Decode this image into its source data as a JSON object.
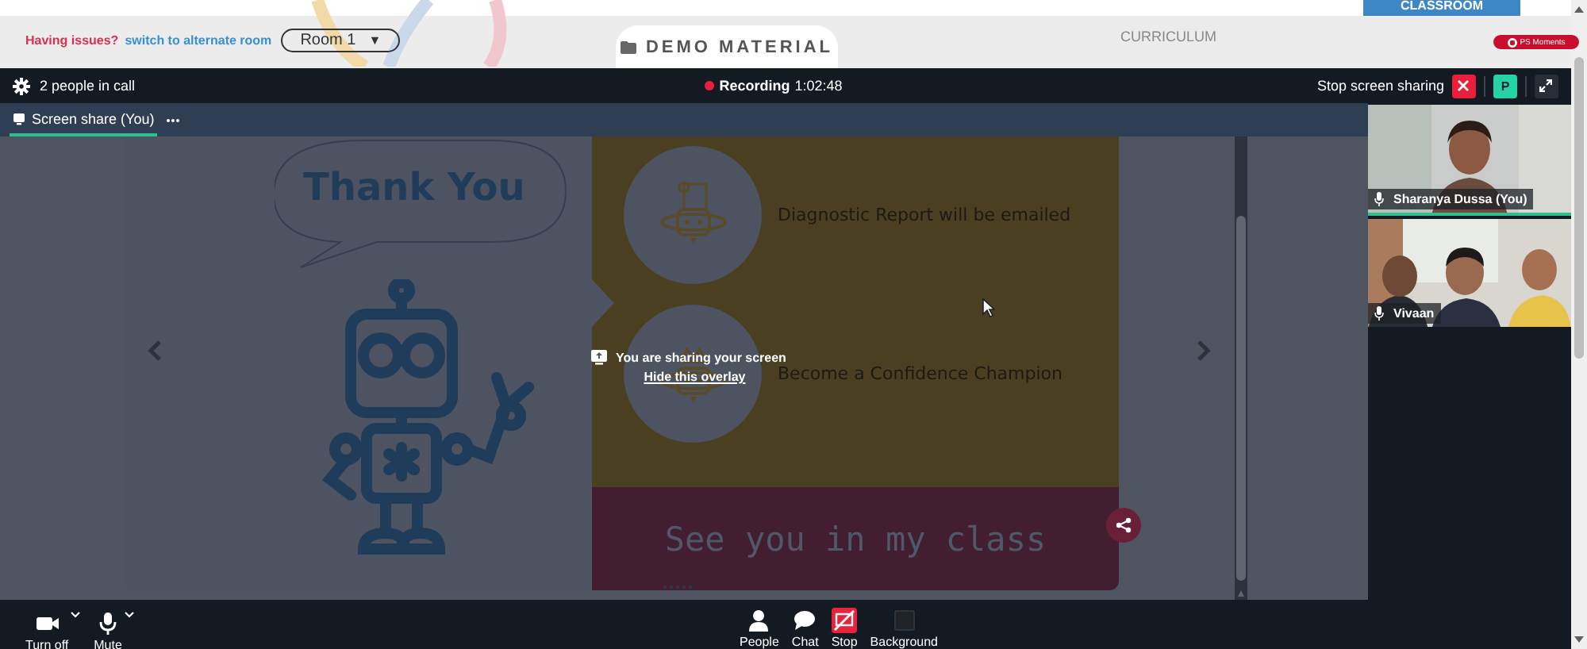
{
  "header": {
    "issue_text": "Having issues?",
    "switch_link": "switch to alternate room",
    "room_select": {
      "value": "Room 1",
      "caret": "▼"
    },
    "demo_material": "DEMO MATERIAL",
    "curriculum": "CURRICULUM",
    "classroom": "CLASSROOM",
    "badge": "PS Moments"
  },
  "call_bar": {
    "people_count": "2 people in call",
    "recording_label": "Recording",
    "recording_time": "1:02:48",
    "stop_sharing": "Stop screen sharing",
    "participant_initial": "P"
  },
  "tabs": [
    {
      "label": "Screen share (You)",
      "selected": true
    }
  ],
  "slide": {
    "title": "Thank You",
    "items": [
      "Diagnostic Report will be emailed",
      "Become a Confidence Champion"
    ],
    "footer": "See you in my class"
  },
  "overlay": {
    "message": "You are sharing your screen",
    "link": "Hide this overlay"
  },
  "participants": [
    {
      "name": "Sharanya Dussa (You)",
      "speaking": true
    },
    {
      "name": "Vivaan",
      "speaking": false
    }
  ],
  "toolbar": {
    "left": [
      {
        "label": "Turn off",
        "kind": "camera"
      },
      {
        "label": "Mute",
        "kind": "mic"
      }
    ],
    "center": [
      {
        "label": "People",
        "kind": "people"
      },
      {
        "label": "Chat",
        "kind": "chat"
      },
      {
        "label": "Stop",
        "kind": "share"
      },
      {
        "label": "Background",
        "kind": "background"
      }
    ]
  }
}
